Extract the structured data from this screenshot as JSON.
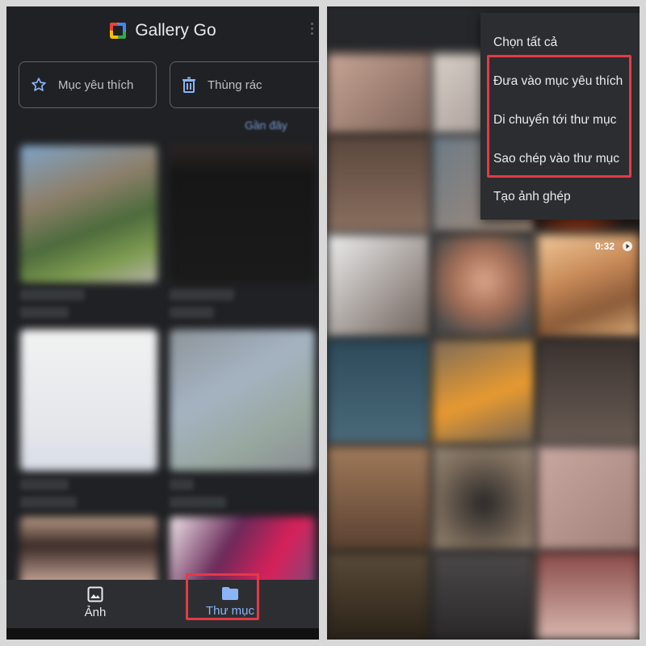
{
  "app": {
    "title": "Gallery Go"
  },
  "quick_actions": {
    "favorites_label": "Mục yêu thích",
    "trash_label": "Thùng rác"
  },
  "sort": {
    "label": "Gần đây"
  },
  "bottom_nav": {
    "photos_label": "Ảnh",
    "folders_label": "Thư mục"
  },
  "context_menu": {
    "items": [
      "Chọn tất cả",
      "Đưa vào mục yêu thích",
      "Di chuyển tới thư mục",
      "Sao chép vào thư mục",
      "Tạo ảnh ghép"
    ]
  },
  "video": {
    "duration": "0:32"
  },
  "colors": {
    "accent": "#8ab4f8",
    "highlight": "#e53946",
    "background": "#202124"
  },
  "icons": {
    "favorites": "star-icon",
    "trash": "trash-icon",
    "photos": "image-icon",
    "folders": "folder-icon",
    "play": "play-icon"
  }
}
